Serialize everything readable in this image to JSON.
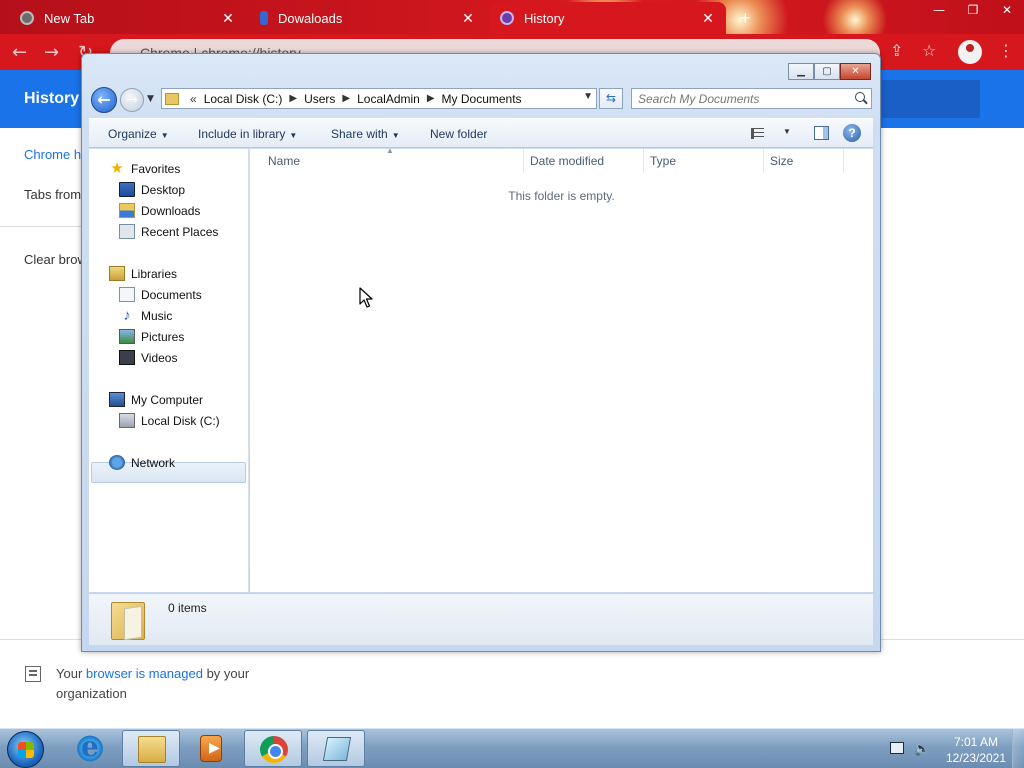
{
  "chrome": {
    "tabs": [
      {
        "title": "New Tab",
        "close": "✕"
      },
      {
        "title": "Dowaloads",
        "close": "✕"
      },
      {
        "title": "History",
        "close": "✕"
      }
    ],
    "new_tab": "+",
    "window_controls": {
      "minimize": "—",
      "restore": "❐",
      "close": "✕"
    },
    "omnibox_text": "Chrome  |  chrome://history",
    "history": {
      "title": "History",
      "sidebar_chrome_history": "Chrome history",
      "sidebar_tabs_other_devices": "Tabs from other devices",
      "sidebar_clear_browsing": "Clear browsing data",
      "managed_prefix": "Your ",
      "managed_link": "browser is managed",
      "managed_suffix": " by your organization"
    }
  },
  "explorer": {
    "caption": {
      "minimize": "▁",
      "maximize": "▢",
      "close": "✕"
    },
    "nav": {
      "back": "←",
      "forward": "→",
      "recent": "▼"
    },
    "breadcrumb": {
      "overflow": "«",
      "items": [
        "Local Disk (C:)",
        "Users",
        "LocalAdmin",
        "My Documents"
      ],
      "separator": "▶",
      "dropdown": "▼"
    },
    "refresh": "⇆",
    "search_placeholder": "Search My Documents",
    "commands": {
      "organize": "Organize",
      "include_in_library": "Include in library",
      "share_with": "Share with",
      "new_folder": "New folder",
      "caret": "▼",
      "help": "?"
    },
    "nav_pane": {
      "favorites": "Favorites",
      "desktop": "Desktop",
      "downloads": "Downloads",
      "recent_places": "Recent Places",
      "libraries": "Libraries",
      "documents": "Documents",
      "music": "Music",
      "pictures": "Pictures",
      "videos": "Videos",
      "my_computer": "My Computer",
      "local_disk": "Local Disk (C:)",
      "network": "Network"
    },
    "columns": [
      "Name",
      "Date modified",
      "Type",
      "Size"
    ],
    "sort_indicator": "▲",
    "empty_message": "This folder is empty.",
    "item_count": "0 items"
  },
  "taskbar": {
    "clock_time": "7:01 AM",
    "clock_date": "12/23/2021"
  }
}
